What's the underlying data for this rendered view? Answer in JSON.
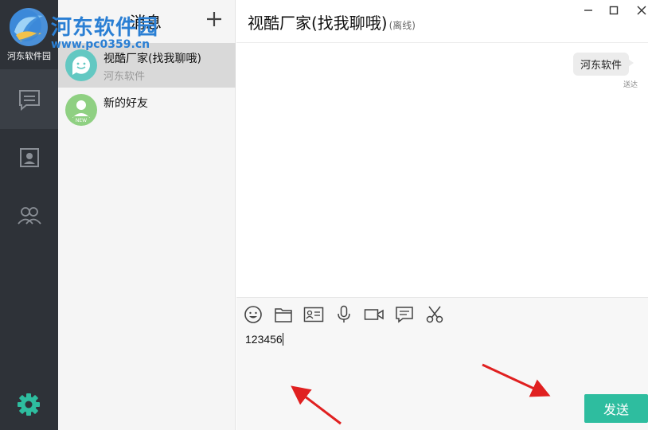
{
  "rail": {
    "user_name": "河东软件园",
    "nav": [
      "chat-bubble-icon",
      "contact-card-icon",
      "group-icon"
    ],
    "settings_icon": "gear-icon"
  },
  "watermark": {
    "text": "河东软件园",
    "url": "www.pc0359.cn"
  },
  "list": {
    "title": "消息",
    "add_icon": "plus-icon",
    "conversations": [
      {
        "name": "视酷厂家(找我聊哦)",
        "subtitle": "河东软件",
        "selected": true
      },
      {
        "name": "新的好友",
        "subtitle": "",
        "badge": "NEW",
        "selected": false
      }
    ]
  },
  "chat": {
    "title": "视酷厂家(找我聊哦)",
    "status": "(离线)",
    "messages": [
      {
        "text": "河东软件",
        "status": "送达",
        "outgoing": true
      }
    ]
  },
  "composer": {
    "tools": [
      "emoji-icon",
      "folder-icon",
      "business-card-icon",
      "microphone-icon",
      "video-icon",
      "chat-icon",
      "scissors-icon"
    ],
    "input_value": "123456",
    "send_label": "发送"
  },
  "colors": {
    "rail_bg": "#2e3238",
    "accent": "#2ebd9f",
    "avatar_teal": "#63c8c2",
    "avatar_green": "#8fd082",
    "annotation_red": "#e02020"
  }
}
